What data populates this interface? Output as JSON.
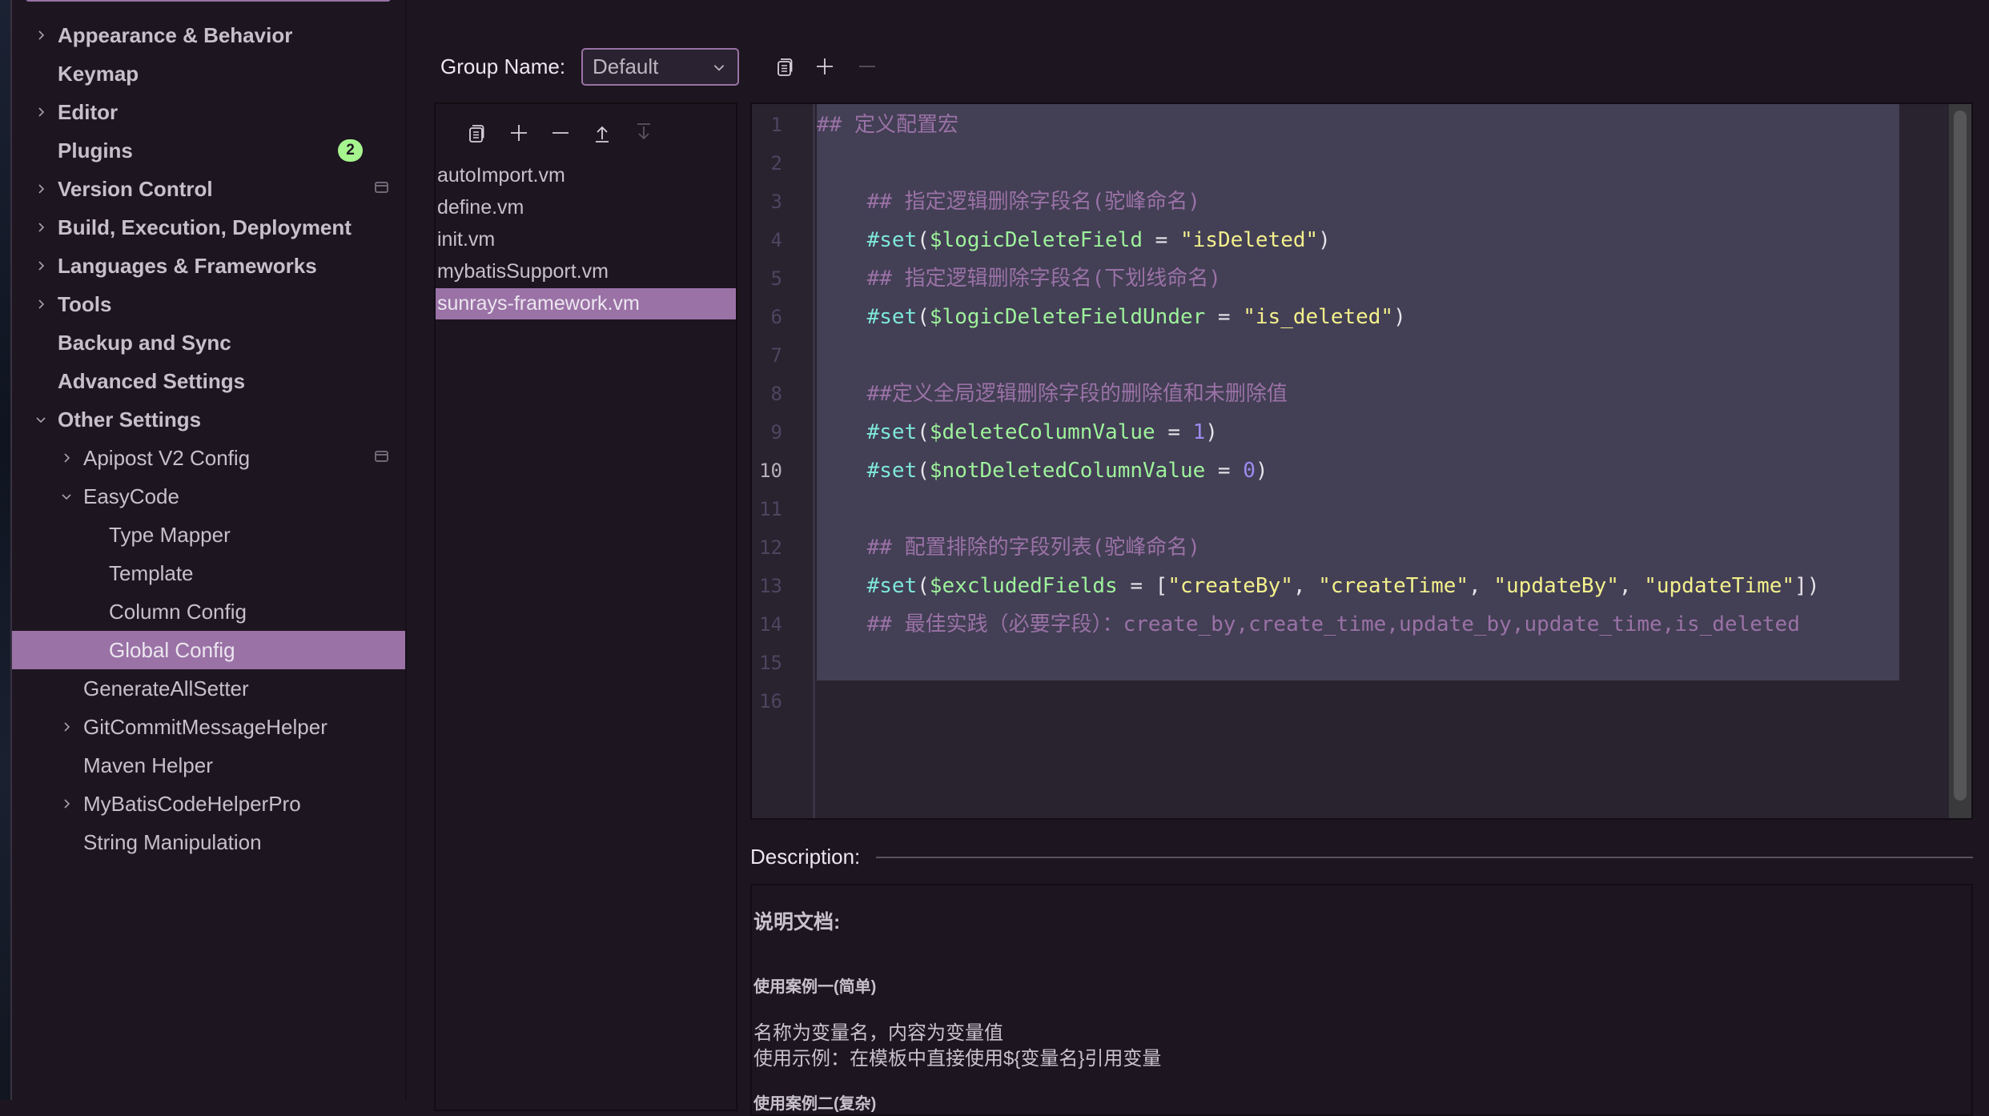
{
  "sidebar": {
    "items": [
      {
        "label": "Appearance & Behavior",
        "level": 0,
        "expander": "collapsed",
        "bold": true
      },
      {
        "label": "Keymap",
        "level": 0,
        "expander": "none",
        "bold": true
      },
      {
        "label": "Editor",
        "level": 0,
        "expander": "collapsed",
        "bold": true
      },
      {
        "label": "Plugins",
        "level": 0,
        "expander": "none",
        "bold": true,
        "badge": "2"
      },
      {
        "label": "Version Control",
        "level": 0,
        "expander": "collapsed",
        "bold": true,
        "project_icon": true
      },
      {
        "label": "Build, Execution, Deployment",
        "level": 0,
        "expander": "collapsed",
        "bold": true
      },
      {
        "label": "Languages & Frameworks",
        "level": 0,
        "expander": "collapsed",
        "bold": true
      },
      {
        "label": "Tools",
        "level": 0,
        "expander": "collapsed",
        "bold": true
      },
      {
        "label": "Backup and Sync",
        "level": 0,
        "expander": "none",
        "bold": true
      },
      {
        "label": "Advanced Settings",
        "level": 0,
        "expander": "none",
        "bold": true
      },
      {
        "label": "Other Settings",
        "level": 0,
        "expander": "expanded",
        "bold": true
      },
      {
        "label": "Apipost V2 Config",
        "level": 1,
        "expander": "collapsed",
        "project_icon": true
      },
      {
        "label": "EasyCode",
        "level": 1,
        "expander": "expanded"
      },
      {
        "label": "Type Mapper",
        "level": 2,
        "expander": "none"
      },
      {
        "label": "Template",
        "level": 2,
        "expander": "none"
      },
      {
        "label": "Column Config",
        "level": 2,
        "expander": "none"
      },
      {
        "label": "Global Config",
        "level": 2,
        "expander": "none",
        "selected": true
      },
      {
        "label": "GenerateAllSetter",
        "level": 1,
        "expander": "none"
      },
      {
        "label": "GitCommitMessageHelper",
        "level": 1,
        "expander": "collapsed"
      },
      {
        "label": "Maven Helper",
        "level": 1,
        "expander": "none"
      },
      {
        "label": "MyBatisCodeHelperPro",
        "level": 1,
        "expander": "collapsed"
      },
      {
        "label": "String Manipulation",
        "level": 1,
        "expander": "none"
      }
    ]
  },
  "group": {
    "label": "Group Name:",
    "selected": "Default",
    "toolbar": [
      {
        "name": "copy-group-button",
        "icon": "copy-icon",
        "enabled": true
      },
      {
        "name": "add-group-button",
        "icon": "plus-icon",
        "enabled": true
      },
      {
        "name": "remove-group-button",
        "icon": "minus-icon",
        "enabled": false
      }
    ]
  },
  "file_list": {
    "toolbar": [
      {
        "name": "copy-file-button",
        "icon": "copy-icon",
        "enabled": true
      },
      {
        "name": "add-file-button",
        "icon": "plus-icon",
        "enabled": true
      },
      {
        "name": "remove-file-button",
        "icon": "minus-icon",
        "enabled": true
      },
      {
        "name": "move-up-button",
        "icon": "arrow-up-icon",
        "enabled": true
      },
      {
        "name": "move-down-button",
        "icon": "arrow-down-icon",
        "enabled": false
      }
    ],
    "items": [
      {
        "label": "autoImport.vm"
      },
      {
        "label": "define.vm"
      },
      {
        "label": "init.vm"
      },
      {
        "label": "mybatisSupport.vm"
      },
      {
        "label": "sunrays-framework.vm",
        "selected": true
      }
    ]
  },
  "editor": {
    "current_line": 10,
    "lines": [
      [
        {
          "t": "comment",
          "v": "## 定义配置宏"
        }
      ],
      [],
      [
        {
          "t": "comment",
          "v": "    ## 指定逻辑删除字段名(驼峰命名)"
        }
      ],
      [
        {
          "t": "plain",
          "v": "    "
        },
        {
          "t": "kw",
          "v": "#set"
        },
        {
          "t": "punc",
          "v": "("
        },
        {
          "t": "var",
          "v": "$logicDeleteField"
        },
        {
          "t": "punc",
          "v": " = "
        },
        {
          "t": "str",
          "v": "\"isDeleted\""
        },
        {
          "t": "punc",
          "v": ")"
        }
      ],
      [
        {
          "t": "comment",
          "v": "    ## 指定逻辑删除字段名(下划线命名)"
        }
      ],
      [
        {
          "t": "plain",
          "v": "    "
        },
        {
          "t": "kw",
          "v": "#set"
        },
        {
          "t": "punc",
          "v": "("
        },
        {
          "t": "var",
          "v": "$logicDeleteFieldUnder"
        },
        {
          "t": "punc",
          "v": " = "
        },
        {
          "t": "str",
          "v": "\"is_deleted\""
        },
        {
          "t": "punc",
          "v": ")"
        }
      ],
      [],
      [
        {
          "t": "comment",
          "v": "    ##定义全局逻辑删除字段的删除值和未删除值"
        }
      ],
      [
        {
          "t": "plain",
          "v": "    "
        },
        {
          "t": "kw",
          "v": "#set"
        },
        {
          "t": "punc",
          "v": "("
        },
        {
          "t": "var",
          "v": "$deleteColumnValue"
        },
        {
          "t": "punc",
          "v": " = "
        },
        {
          "t": "num",
          "v": "1"
        },
        {
          "t": "punc",
          "v": ")"
        }
      ],
      [
        {
          "t": "plain",
          "v": "    "
        },
        {
          "t": "kw",
          "v": "#set"
        },
        {
          "t": "punc",
          "v": "("
        },
        {
          "t": "var",
          "v": "$notDeletedColumnValue"
        },
        {
          "t": "punc",
          "v": " = "
        },
        {
          "t": "num",
          "v": "0"
        },
        {
          "t": "punc",
          "v": ")"
        }
      ],
      [],
      [
        {
          "t": "comment",
          "v": "    ## 配置排除的字段列表(驼峰命名)"
        }
      ],
      [
        {
          "t": "plain",
          "v": "    "
        },
        {
          "t": "kw",
          "v": "#set"
        },
        {
          "t": "punc",
          "v": "("
        },
        {
          "t": "var",
          "v": "$excludedFields"
        },
        {
          "t": "punc",
          "v": " = ["
        },
        {
          "t": "str",
          "v": "\"createBy\""
        },
        {
          "t": "punc",
          "v": ", "
        },
        {
          "t": "str",
          "v": "\"createTime\""
        },
        {
          "t": "punc",
          "v": ", "
        },
        {
          "t": "str",
          "v": "\"updateBy\""
        },
        {
          "t": "punc",
          "v": ", "
        },
        {
          "t": "str",
          "v": "\"updateTime\""
        },
        {
          "t": "punc",
          "v": "])"
        }
      ],
      [
        {
          "t": "comment",
          "v": "    ## 最佳实践（必要字段）：create_by,create_time,update_by,update_time,is_deleted"
        }
      ],
      [],
      []
    ]
  },
  "description": {
    "label": "Description:",
    "heading": "说明文档:",
    "case1_title": "使用案例一(简单)",
    "case1_line1": "名称为变量名，内容为变量值",
    "case1_line2": "使用示例：在模板中直接使用${变量名}引用变量",
    "case2_title": "使用案例二(复杂)"
  },
  "colors": {
    "accent": "#9a72a6",
    "badge": "#a6f58f",
    "background": "#1d1520",
    "editor_selection": "#433f55"
  }
}
